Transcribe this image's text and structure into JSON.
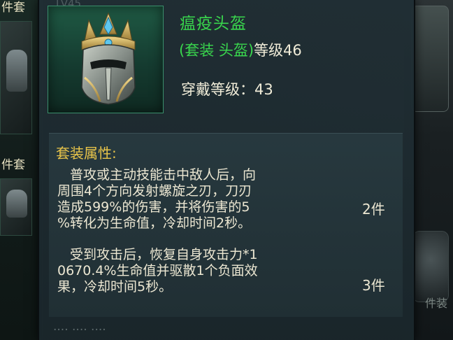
{
  "background": {
    "left_tab_top": "件套",
    "left_tab_mid": "件套",
    "right_text": "件装"
  },
  "tooltip": {
    "level_ghost": "LV45",
    "item": {
      "name": "瘟疫头盔",
      "type_set": "(套装 头盔)",
      "type_level": "等级46",
      "wear_level": "穿戴等级：43",
      "icon": "crowned-helmet-icon",
      "rarity_color": "#39d64d"
    },
    "set": {
      "title": "套装属性:",
      "entries": [
        {
          "lines": [
            "普攻或主动技能击中敌人后，向",
            "周围4个方向发射螺旋之刃，刀刃",
            "造成599%的伤害，并将伤害的5",
            "%转化为生命值，冷却时间2秒。"
          ],
          "count": "2件"
        },
        {
          "lines": [
            "受到攻击后，恢复自身攻击力*1",
            "0670.4%生命值并驱散1个负面效",
            "果，冷却时间5秒。"
          ],
          "count": "3件"
        }
      ]
    },
    "bottom_ghost": "···· ···· ····"
  }
}
